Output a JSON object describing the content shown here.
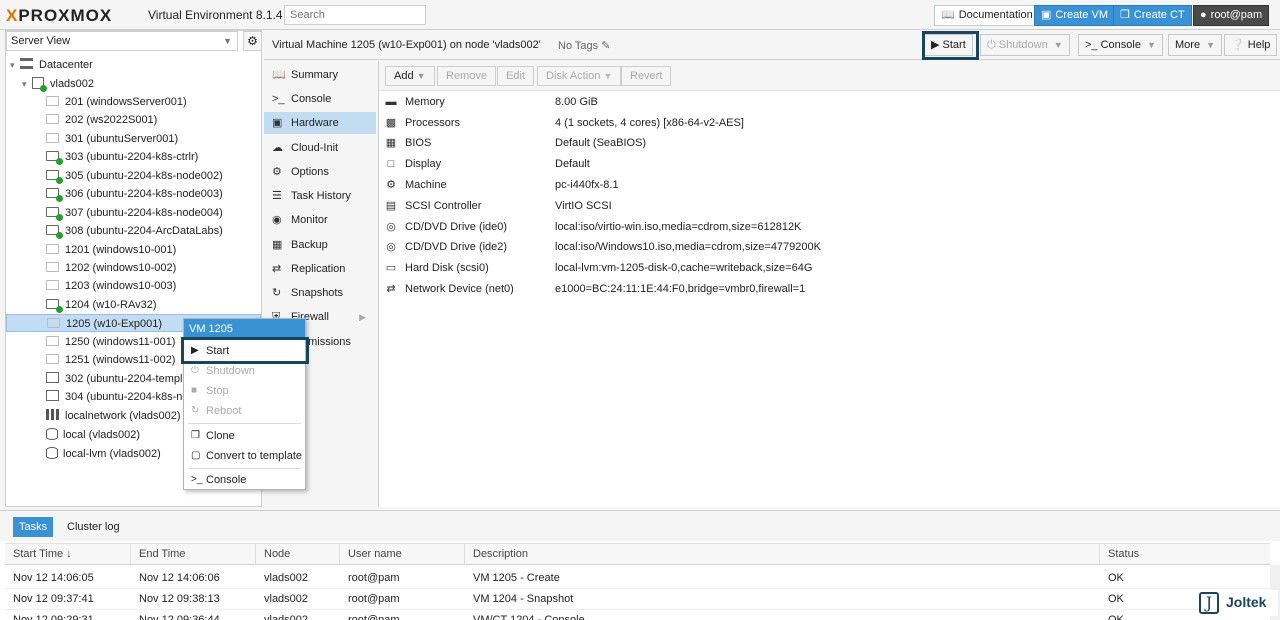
{
  "topbar": {
    "brand": "PROXMOX",
    "brand_x": "X",
    "subtitle": "Virtual Environment 8.1.4",
    "search_placeholder": "Search",
    "documentation": "Documentation",
    "create_vm": "Create VM",
    "create_ct": "Create CT",
    "user": "root@pam"
  },
  "tree": {
    "view": "Server View",
    "datacenter": "Datacenter",
    "node": "vlads002",
    "items": [
      {
        "label": "201 (windowsServer001)",
        "state": "off"
      },
      {
        "label": "202 (ws2022S001)",
        "state": "off"
      },
      {
        "label": "301 (ubuntuServer001)",
        "state": "off"
      },
      {
        "label": "303 (ubuntu-2204-k8s-ctrlr)",
        "state": "on"
      },
      {
        "label": "305 (ubuntu-2204-k8s-node002)",
        "state": "on"
      },
      {
        "label": "306 (ubuntu-2204-k8s-node003)",
        "state": "on"
      },
      {
        "label": "307 (ubuntu-2204-k8s-node004)",
        "state": "on"
      },
      {
        "label": "308 (ubuntu-2204-ArcDataLabs)",
        "state": "on"
      },
      {
        "label": "1201 (windows10-001)",
        "state": "off"
      },
      {
        "label": "1202 (windows10-002)",
        "state": "off"
      },
      {
        "label": "1203 (windows10-003)",
        "state": "off"
      },
      {
        "label": "1204 (w10-RAv32)",
        "state": "on"
      },
      {
        "label": "1205 (w10-Exp001)",
        "state": "off"
      },
      {
        "label": "1250 (windows11-001)",
        "state": "off"
      },
      {
        "label": "1251 (windows11-002)",
        "state": "off"
      },
      {
        "label": "302 (ubuntu-2204-templ",
        "state": "tpl"
      },
      {
        "label": "304 (ubuntu-2204-k8s-no",
        "state": "tpl"
      },
      {
        "label": "localnetwork (vlads002)",
        "state": "net"
      },
      {
        "label": "local (vlads002)",
        "state": "sto"
      },
      {
        "label": "local-lvm (vlads002)",
        "state": "sto"
      }
    ]
  },
  "context_menu": {
    "title": "VM 1205",
    "start": "Start",
    "shutdown": "Shutdown",
    "stop": "Stop",
    "reboot": "Reboot",
    "clone": "Clone",
    "convert": "Convert to template",
    "console": "Console"
  },
  "header": {
    "title": "Virtual Machine 1205 (w10-Exp001) on node 'vlads002'",
    "tags": "No Tags",
    "start": "Start",
    "shutdown": "Shutdown",
    "console": "Console",
    "more": "More",
    "help": "Help"
  },
  "nav": [
    "Summary",
    "Console",
    "Hardware",
    "Cloud-Init",
    "Options",
    "Task History",
    "Monitor",
    "Backup",
    "Replication",
    "Snapshots",
    "Firewall",
    "Permissions"
  ],
  "hw_toolbar": {
    "add": "Add",
    "remove": "Remove",
    "edit": "Edit",
    "disk_action": "Disk Action",
    "revert": "Revert"
  },
  "hardware": [
    {
      "key": "Memory",
      "value": "8.00 GiB",
      "icon": "memory-icon"
    },
    {
      "key": "Processors",
      "value": "4 (1 sockets, 4 cores) [x86-64-v2-AES]",
      "icon": "cpu-icon"
    },
    {
      "key": "BIOS",
      "value": "Default (SeaBIOS)",
      "icon": "microchip-icon"
    },
    {
      "key": "Display",
      "value": "Default",
      "icon": "monitor-icon"
    },
    {
      "key": "Machine",
      "value": "pc-i440fx-8.1",
      "icon": "cogs-icon"
    },
    {
      "key": "SCSI Controller",
      "value": "VirtIO SCSI",
      "icon": "database-icon"
    },
    {
      "key": "CD/DVD Drive (ide0)",
      "value": "local:iso/virtio-win.iso,media=cdrom,size=612812K",
      "icon": "cdrom-icon"
    },
    {
      "key": "CD/DVD Drive (ide2)",
      "value": "local:iso/Windows10.iso,media=cdrom,size=4779200K",
      "icon": "cdrom-icon"
    },
    {
      "key": "Hard Disk (scsi0)",
      "value": "local-lvm:vm-1205-disk-0,cache=writeback,size=64G",
      "icon": "hdd-icon"
    },
    {
      "key": "Network Device (net0)",
      "value": "e1000=BC:24:11:1E:44:F0,bridge=vmbr0,firewall=1",
      "icon": "network-icon"
    }
  ],
  "bottom": {
    "tabs": [
      "Tasks",
      "Cluster log"
    ],
    "columns": [
      "Start Time ↓",
      "End Time",
      "Node",
      "User name",
      "Description",
      "Status"
    ],
    "rows": [
      [
        "Nov 12 14:06:05",
        "Nov 12 14:06:06",
        "vlads002",
        "root@pam",
        "VM 1205 - Create",
        "OK"
      ],
      [
        "Nov 12 09:37:41",
        "Nov 12 09:38:13",
        "vlads002",
        "root@pam",
        "VM 1204 - Snapshot",
        "OK"
      ],
      [
        "Nov 12 09:29:31",
        "Nov 12 09:36:44",
        "vlads002",
        "root@pam",
        "VM/CT 1204 - Console",
        "OK"
      ]
    ]
  },
  "watermark": {
    "letter": "J",
    "text": "Joltek"
  }
}
